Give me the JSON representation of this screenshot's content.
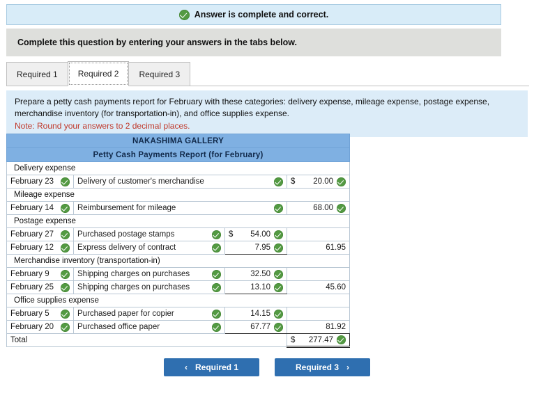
{
  "banner": {
    "icon": "check-circle-icon",
    "text": "Answer is complete and correct."
  },
  "instruction": {
    "text": "Complete this question by entering your answers in the tabs below."
  },
  "tabs": [
    {
      "label": "Required 1",
      "active": false
    },
    {
      "label": "Required 2",
      "active": true
    },
    {
      "label": "Required 3",
      "active": false
    }
  ],
  "prompt": {
    "text": "Prepare a petty cash payments report for February with these categories: delivery expense, mileage expense, postage expense, merchandise inventory (for transportation-in), and office supplies expense.",
    "note": "Note: Round your answers to 2 decimal places."
  },
  "report": {
    "company": "NAKASHIMA GALLERY",
    "title": "Petty Cash Payments Report (for February)",
    "sections": [
      {
        "category": "Delivery expense",
        "rows": [
          {
            "date": "February 23",
            "description": "Delivery of customer's merchandise",
            "amount1": "",
            "dollar1": false,
            "amount2": "20.00",
            "dollar2": true
          }
        ]
      },
      {
        "category": "Mileage expense",
        "rows": [
          {
            "date": "February 14",
            "description": "Reimbursement for mileage",
            "amount1": "",
            "dollar1": false,
            "amount2": "68.00",
            "dollar2": false
          }
        ]
      },
      {
        "category": "Postage expense",
        "rows": [
          {
            "date": "February 27",
            "description": "Purchased postage stamps",
            "amount1": "54.00",
            "dollar1": true,
            "amount2": "",
            "dollar2": false
          },
          {
            "date": "February 12",
            "description": "Express delivery of contract",
            "amount1": "7.95",
            "dollar1": false,
            "amount2": "61.95",
            "dollar2": false
          }
        ]
      },
      {
        "category": "Merchandise inventory (transportation-in)",
        "rows": [
          {
            "date": "February 9",
            "description": "Shipping charges on purchases",
            "amount1": "32.50",
            "dollar1": false,
            "amount2": "",
            "dollar2": false
          },
          {
            "date": "February 25",
            "description": "Shipping charges on purchases",
            "amount1": "13.10",
            "dollar1": false,
            "amount2": "45.60",
            "dollar2": false
          }
        ]
      },
      {
        "category": "Office supplies expense",
        "rows": [
          {
            "date": "February 5",
            "description": "Purchased paper for copier",
            "amount1": "14.15",
            "dollar1": false,
            "amount2": "",
            "dollar2": false
          },
          {
            "date": "February 20",
            "description": "Purchased office paper",
            "amount1": "67.77",
            "dollar1": false,
            "amount2": "81.92",
            "dollar2": false
          }
        ]
      }
    ],
    "total": {
      "label": "Total",
      "dollar": "$",
      "value": "277.47"
    }
  },
  "footer": {
    "prev_label": "Required 1",
    "prev_arrow": "‹",
    "next_label": "Required 3",
    "next_arrow": "›"
  },
  "colors": {
    "banner_bg": "#d8ecf8",
    "instruction_bg": "#dedfdc",
    "prompt_bg": "#dcecf8",
    "table_header_bg": "#7fb0e2",
    "button_blue": "#2f6fb0",
    "check_green": "#539a42",
    "note_red": "#c0392b"
  }
}
